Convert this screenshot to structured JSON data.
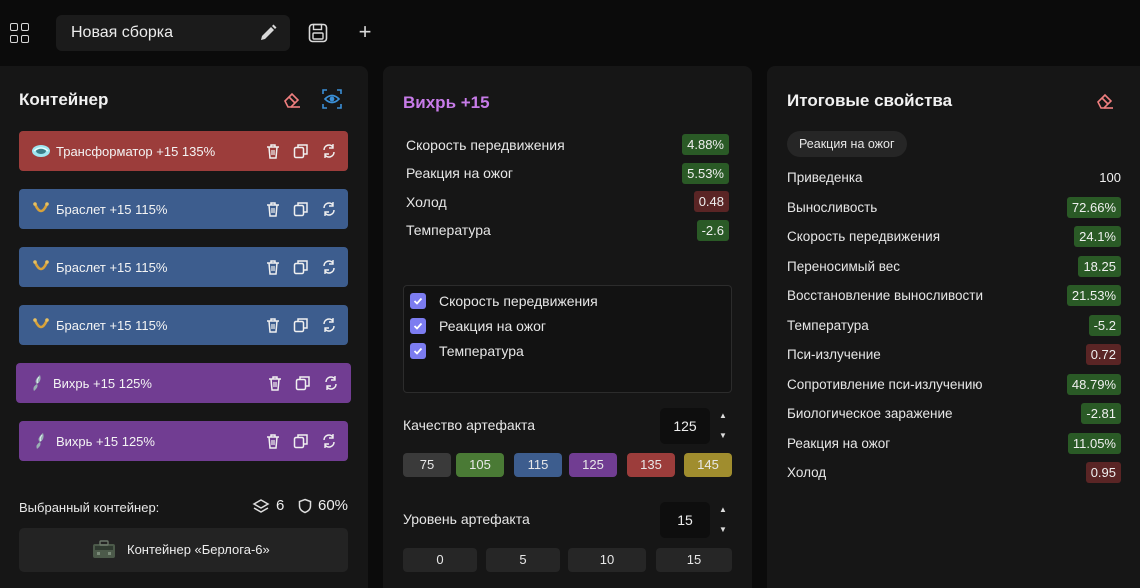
{
  "topbar": {
    "build_name": "Новая сборка"
  },
  "container_panel": {
    "title": "Контейнер",
    "items": [
      {
        "label": "Трансформатор +15 135%",
        "color": "#9c3d3b",
        "icon": "transformer-artifact-icon"
      },
      {
        "label": "Браслет +15 115%",
        "color": "#3d5d8e",
        "icon": "bracelet-artifact-icon"
      },
      {
        "label": "Браслет +15 115%",
        "color": "#3d5d8e",
        "icon": "bracelet-artifact-icon"
      },
      {
        "label": "Браслет +15 115%",
        "color": "#3d5d8e",
        "icon": "bracelet-artifact-icon"
      },
      {
        "label": "Вихрь +15 125%",
        "color": "#713d92",
        "icon": "vortex-artifact-icon"
      },
      {
        "label": "Вихрь +15 125%",
        "color": "#713d92",
        "icon": "vortex-artifact-icon"
      }
    ],
    "selected_label": "Выбранный контейнер:",
    "slots": "6",
    "protection": "60%",
    "container_name": "Контейнер «Берлога-6»"
  },
  "artifact_panel": {
    "title": "Вихрь +15",
    "stats": [
      {
        "name": "Скорость передвижения",
        "value": "4.88%",
        "tone": "g"
      },
      {
        "name": "Реакция на ожог",
        "value": "5.53%",
        "tone": "g"
      },
      {
        "name": "Холод",
        "value": "0.48",
        "tone": "r"
      },
      {
        "name": "Температура",
        "value": "-2.6",
        "tone": "g"
      }
    ],
    "checks": [
      {
        "label": "Скорость передвижения",
        "checked": true
      },
      {
        "label": "Реакция на ожог",
        "checked": true
      },
      {
        "label": "Температура",
        "checked": true
      }
    ],
    "quality_label": "Качество артефакта",
    "quality_value": "125",
    "quality_options": [
      {
        "label": "75",
        "color": "#3a3a3a"
      },
      {
        "label": "105",
        "color": "#4a7a35"
      },
      {
        "label": "115",
        "color": "#3d5d8e"
      },
      {
        "label": "125",
        "color": "#713d92"
      },
      {
        "label": "135",
        "color": "#9c3d3b"
      },
      {
        "label": "145",
        "color": "#a08d2e"
      }
    ],
    "level_label": "Уровень артефакта",
    "level_value": "15",
    "level_options": [
      "0",
      "5",
      "10",
      "15"
    ]
  },
  "summary_panel": {
    "title": "Итоговые свойства",
    "chip": "Реакция на ожог",
    "stats": [
      {
        "name": "Приведенка",
        "value": "100",
        "tone": "n"
      },
      {
        "name": "Выносливость",
        "value": "72.66%",
        "tone": "g"
      },
      {
        "name": "Скорость передвижения",
        "value": "24.1%",
        "tone": "g"
      },
      {
        "name": "Переносимый вес",
        "value": "18.25",
        "tone": "g"
      },
      {
        "name": "Восстановление выносливости",
        "value": "21.53%",
        "tone": "g"
      },
      {
        "name": "Температура",
        "value": "-5.2",
        "tone": "g"
      },
      {
        "name": "Пси-излучение",
        "value": "0.72",
        "tone": "r"
      },
      {
        "name": "Сопротивление пси-излучению",
        "value": "48.79%",
        "tone": "g"
      },
      {
        "name": "Биологическое заражение",
        "value": "-2.81",
        "tone": "g"
      },
      {
        "name": "Реакция на ожог",
        "value": "11.05%",
        "tone": "g"
      },
      {
        "name": "Холод",
        "value": "0.95",
        "tone": "r"
      }
    ]
  }
}
